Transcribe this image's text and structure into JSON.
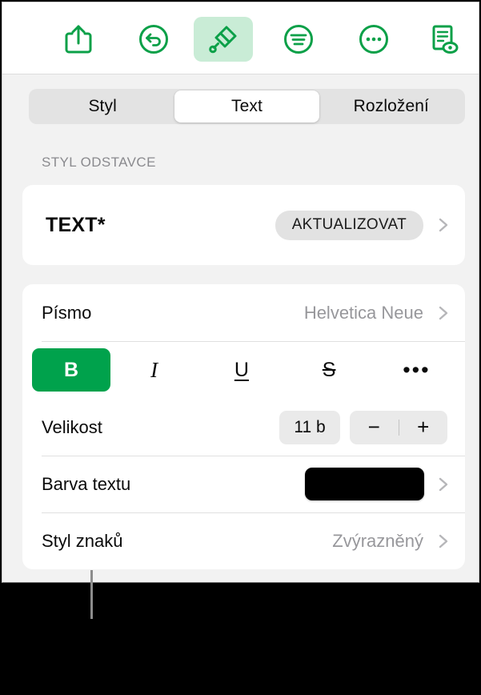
{
  "toolbar": {
    "items": [
      {
        "name": "share-icon",
        "label": "Sdílet",
        "active": false
      },
      {
        "name": "undo-icon",
        "label": "Zpět",
        "active": false
      },
      {
        "name": "paintbrush-icon",
        "label": "Formát",
        "active": true
      },
      {
        "name": "insert-icon",
        "label": "Vložit",
        "active": false
      },
      {
        "name": "more-icon",
        "label": "Více",
        "active": false
      },
      {
        "name": "document-preview-icon",
        "label": "Dokument",
        "active": false
      }
    ],
    "accent_color": "#00A24C",
    "active_background": "#C9ECD6"
  },
  "segmented_control": {
    "tabs": [
      {
        "label": "Styl",
        "selected": false
      },
      {
        "label": "Text",
        "selected": true
      },
      {
        "label": "Rozložení",
        "selected": false
      }
    ]
  },
  "paragraph_section": {
    "header": "STYL ODSTAVCE",
    "style_name": "TEXT*",
    "update_label": "AKTUALIZOVAT"
  },
  "text_section": {
    "font": {
      "label": "Písmo",
      "value": "Helvetica Neue"
    },
    "format_buttons": [
      {
        "name": "bold-button",
        "label": "B",
        "active": true
      },
      {
        "name": "italic-button",
        "label": "I",
        "active": false
      },
      {
        "name": "underline-button",
        "label": "U",
        "active": false
      },
      {
        "name": "strikethrough-button",
        "label": "S",
        "active": false
      },
      {
        "name": "more-format-button",
        "label": "•••",
        "active": false
      }
    ],
    "size": {
      "label": "Velikost",
      "value": "11 b",
      "decrease_label": "−",
      "increase_label": "+"
    },
    "text_color": {
      "label": "Barva textu",
      "value_color": "#000000"
    },
    "character_style": {
      "label": "Styl znaků",
      "value": "Zvýrazněný"
    }
  },
  "callout": {
    "line_color": "#8C8C8C"
  }
}
